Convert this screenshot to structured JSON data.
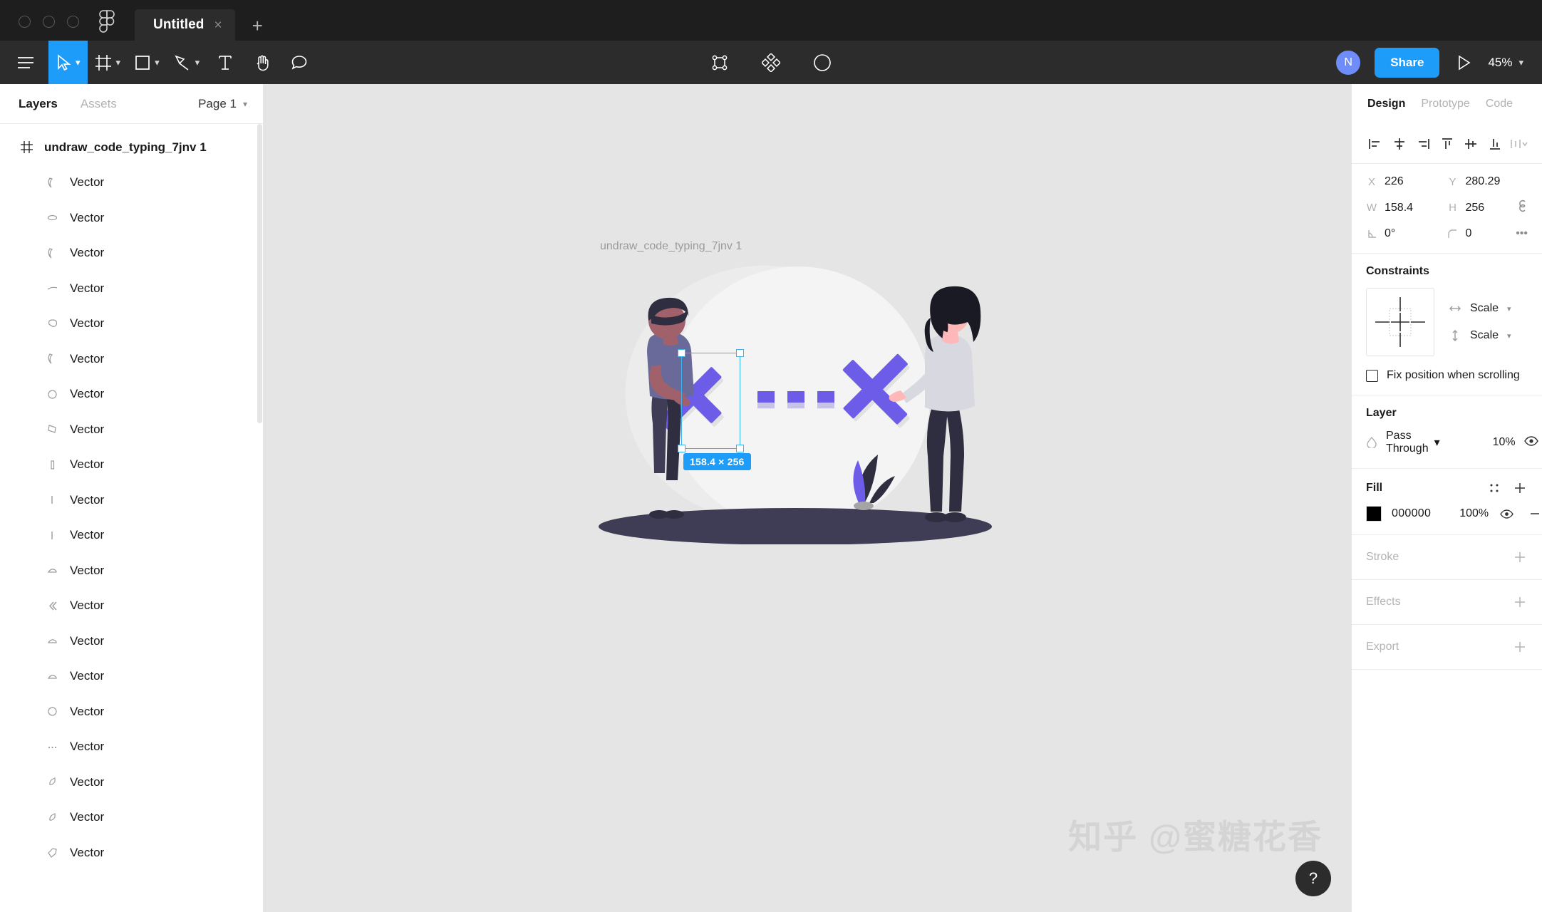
{
  "titlebar": {
    "tab_title": "Untitled",
    "close_label": "×",
    "new_tab_label": "+",
    "logo_name": "figma-logo"
  },
  "toolbar": {
    "menu_icon": "hamburger-menu-icon",
    "tools": [
      {
        "name": "move-tool",
        "icon": "cursor-arrow-icon",
        "active": true,
        "has_caret": true
      },
      {
        "name": "frame-tool",
        "icon": "frame-icon",
        "active": false,
        "has_caret": true
      },
      {
        "name": "shape-tool",
        "icon": "rectangle-icon",
        "active": false,
        "has_caret": true
      },
      {
        "name": "pen-tool",
        "icon": "pen-icon",
        "active": false,
        "has_caret": true
      },
      {
        "name": "text-tool",
        "icon": "text-icon",
        "active": false,
        "has_caret": false
      },
      {
        "name": "hand-tool",
        "icon": "hand-icon",
        "active": false,
        "has_caret": false
      },
      {
        "name": "comment-tool",
        "icon": "comment-bubble-icon",
        "active": false,
        "has_caret": false
      }
    ],
    "center_tools": [
      {
        "name": "mask-tool",
        "icon": "use-as-mask-icon"
      },
      {
        "name": "component-tool",
        "icon": "create-component-icon"
      },
      {
        "name": "boolean-tool",
        "icon": "contrast-circle-icon"
      }
    ],
    "avatar_initial": "N",
    "share_label": "Share",
    "present_icon": "play-triangle-icon",
    "zoom_level": "45%"
  },
  "left_panel": {
    "tabs": [
      {
        "label": "Layers",
        "active": true
      },
      {
        "label": "Assets",
        "active": false
      }
    ],
    "page_selector": "Page 1",
    "root_layer": {
      "name": "undraw_code_typing_7jnv 1",
      "icon": "frame-icon"
    },
    "layers": [
      {
        "name": "Vector",
        "icon": "vector-path-icon"
      },
      {
        "name": "Vector",
        "icon": "vector-ellipse-icon"
      },
      {
        "name": "Vector",
        "icon": "vector-path-icon"
      },
      {
        "name": "Vector",
        "icon": "vector-line-icon"
      },
      {
        "name": "Vector",
        "icon": "vector-blob-icon"
      },
      {
        "name": "Vector",
        "icon": "vector-path-icon"
      },
      {
        "name": "Vector",
        "icon": "vector-circle-icon"
      },
      {
        "name": "Vector",
        "icon": "vector-quad-icon"
      },
      {
        "name": "Vector",
        "icon": "vector-bar-icon"
      },
      {
        "name": "Vector",
        "icon": "vector-stroke-icon"
      },
      {
        "name": "Vector",
        "icon": "vector-stroke-icon"
      },
      {
        "name": "Vector",
        "icon": "vector-shoe-icon"
      },
      {
        "name": "Vector",
        "icon": "vector-chevron-icon"
      },
      {
        "name": "Vector",
        "icon": "vector-shoe-icon"
      },
      {
        "name": "Vector",
        "icon": "vector-shoe-icon"
      },
      {
        "name": "Vector",
        "icon": "vector-circle-icon"
      },
      {
        "name": "Vector",
        "icon": "vector-dots-icon"
      },
      {
        "name": "Vector",
        "icon": "vector-curl-icon"
      },
      {
        "name": "Vector",
        "icon": "vector-curl-icon"
      },
      {
        "name": "Vector",
        "icon": "vector-tag-icon"
      }
    ]
  },
  "canvas": {
    "frame_label": "undraw_code_typing_7jnv 1",
    "selection_size_badge": "158.4 × 256",
    "watermark": "知乎 @蜜糖花香",
    "help_label": "?",
    "colors": {
      "background": "#e5e5e5",
      "accent_blue": "#1e9cf9",
      "illus_purple": "#6c5ce7",
      "illus_dark": "#3f3d56",
      "illus_circle": "#f2f2f2",
      "skin": "#ffb8b8"
    }
  },
  "right_panel": {
    "tabs": [
      {
        "label": "Design",
        "active": true
      },
      {
        "label": "Prototype",
        "active": false
      },
      {
        "label": "Code",
        "active": false
      }
    ],
    "align_buttons": [
      {
        "name": "align-left-icon",
        "dim": false
      },
      {
        "name": "align-horizontal-center-icon",
        "dim": false
      },
      {
        "name": "align-right-icon",
        "dim": false
      },
      {
        "name": "align-top-icon",
        "dim": false
      },
      {
        "name": "align-vertical-center-icon",
        "dim": false
      },
      {
        "name": "align-bottom-icon",
        "dim": false
      },
      {
        "name": "distribute-icon",
        "dim": true
      }
    ],
    "transform": {
      "x_label": "X",
      "x_value": "226",
      "y_label": "Y",
      "y_value": "280.29",
      "w_label": "W",
      "w_value": "158.4",
      "h_label": "H",
      "h_value": "256",
      "rotation_value": "0°",
      "corner_radius_value": "0",
      "more_label": "•••"
    },
    "constraints": {
      "title": "Constraints",
      "horizontal": "Scale",
      "vertical": "Scale",
      "fix_position_label": "Fix position when scrolling"
    },
    "layer": {
      "title": "Layer",
      "blend_mode": "Pass Through",
      "opacity": "10%"
    },
    "fill": {
      "title": "Fill",
      "hex": "000000",
      "opacity": "100%",
      "swatch_color": "#000000"
    },
    "stroke": {
      "title": "Stroke"
    },
    "effects": {
      "title": "Effects"
    },
    "export": {
      "title": "Export"
    }
  }
}
